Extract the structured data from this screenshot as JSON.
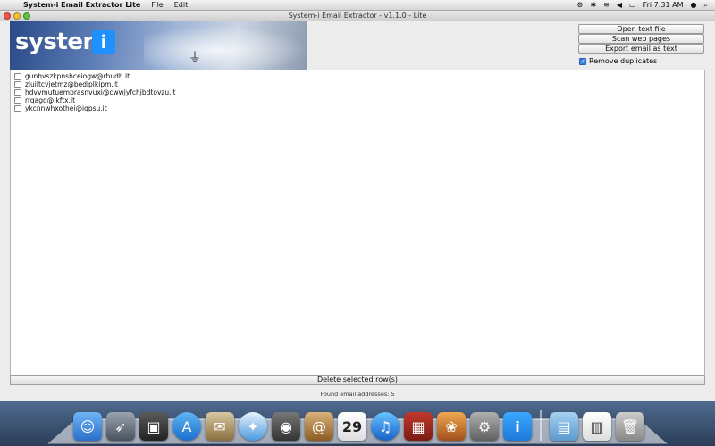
{
  "menubar": {
    "apple_icon": "apple-icon",
    "app_name": "System-i Email Extractor Lite",
    "menus": [
      "File",
      "Edit"
    ],
    "clock": "Fri 7:31 AM"
  },
  "window": {
    "title": "System-i Email Extractor - v1.1.0 - Lite"
  },
  "banner": {
    "logo_text": "system",
    "logo_i": "i"
  },
  "buttons": {
    "open": "Open text file",
    "scan": "Scan web pages",
    "export": "Export email as text"
  },
  "remove_duplicates": {
    "label": "Remove duplicates",
    "checked": true
  },
  "emails": [
    "gunhvszkpnshceiogw@rhudh.it",
    "zluiltcvjetmz@bedlplkipm.it",
    "hdvvmutuemprasnvuxi@cwwjyfchjbdtovzu.it",
    "rrqagd@lkftx.it",
    "ykcnnwhxothei@iqpsu.it"
  ],
  "delete_button": "Delete selected row(s)",
  "status": "Found email addresses: 5",
  "dock_icons": [
    "finder-icon",
    "launchpad-icon",
    "photo-booth-icon",
    "app-store-icon",
    "mail-icon",
    "safari-icon",
    "facetime-icon",
    "address-book-icon",
    "calendar-icon",
    "itunes-icon",
    "photo-icon",
    "iphoto-icon",
    "system-preferences-icon",
    "system-i-icon",
    "folder-icon",
    "document-icon",
    "trash-icon"
  ],
  "calendar_day": "29",
  "colors": {
    "accent": "#3b7fe0",
    "logo_blue": "#1e90ff"
  }
}
